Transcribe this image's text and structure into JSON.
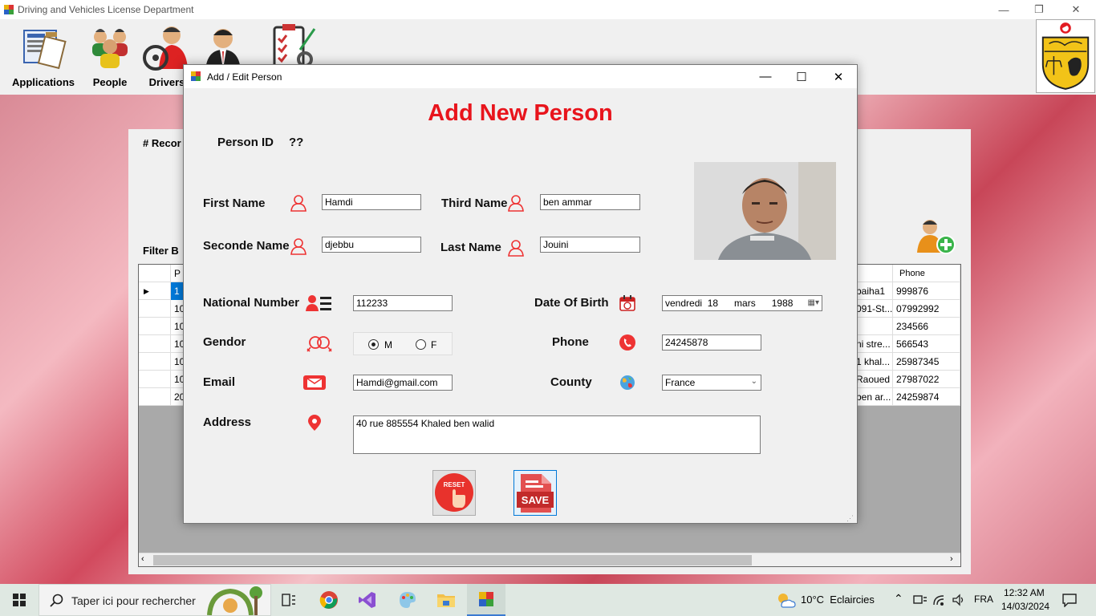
{
  "main_window": {
    "title": "Driving and Vehicles License Department",
    "controls": {
      "minimize": "—",
      "restore": "❐",
      "close": "✕"
    }
  },
  "toolbar": {
    "items": [
      {
        "label": "Applications",
        "icon": "applications-icon"
      },
      {
        "label": "People",
        "icon": "people-icon"
      },
      {
        "label": "Drivers",
        "icon": "drivers-icon"
      },
      {
        "label": "",
        "icon": "users-icon"
      },
      {
        "label": "",
        "icon": "settings-checklist-icon"
      }
    ]
  },
  "people_panel": {
    "records_label": "# Recor",
    "filter_label": "Filter B",
    "grid": {
      "headers": {
        "col1": "P",
        "phone": "Phone"
      },
      "rows": [
        {
          "id": "1",
          "fragment": "baiha1",
          "phone": "999876"
        },
        {
          "id": "10",
          "fragment": "091-St...",
          "phone": "07992992"
        },
        {
          "id": "10",
          "fragment": "",
          "phone": "234566"
        },
        {
          "id": "10",
          "fragment": "ni stre...",
          "phone": "566543"
        },
        {
          "id": "10",
          "fragment": "1 khal...",
          "phone": "25987345"
        },
        {
          "id": "10",
          "fragment": "Raoued",
          "phone": "27987022"
        },
        {
          "id": "20",
          "fragment": "ben ar...",
          "phone": "24259874"
        }
      ],
      "row_indicator": "▶"
    }
  },
  "dialog": {
    "title": "Add / Edit Person",
    "heading": "Add New Person",
    "heading_color": "#e8141c",
    "person_id_label": "Person ID",
    "person_id_value": "??",
    "fields": {
      "first_name": {
        "label": "First Name",
        "value": "Hamdi"
      },
      "second_name": {
        "label": "Seconde Name",
        "value": "djebbu"
      },
      "third_name": {
        "label": "Third Name",
        "value": "ben ammar"
      },
      "last_name": {
        "label": "Last Name",
        "value": "Jouini"
      },
      "national_number": {
        "label": "National Number",
        "value": "112233"
      },
      "date_of_birth": {
        "label": "Date Of Birth",
        "value": "vendredi  18      mars      1988"
      },
      "gender": {
        "label": "Gendor",
        "option_m": "M",
        "option_f": "F",
        "selected": "M"
      },
      "phone": {
        "label": "Phone",
        "value": "24245878"
      },
      "email": {
        "label": "Email",
        "value": "Hamdi@gmail.com"
      },
      "country": {
        "label": "County",
        "value": "France"
      },
      "address": {
        "label": "Address",
        "value": "40 rue 885554 Khaled ben walid"
      }
    },
    "buttons": {
      "reset": "RESET",
      "save": "SAVE"
    }
  },
  "taskbar": {
    "search_placeholder": "Taper ici pour rechercher",
    "weather": "10°C  Eclaircies",
    "language": "FRA",
    "time": "12:32 AM",
    "date": "14/03/2024"
  }
}
